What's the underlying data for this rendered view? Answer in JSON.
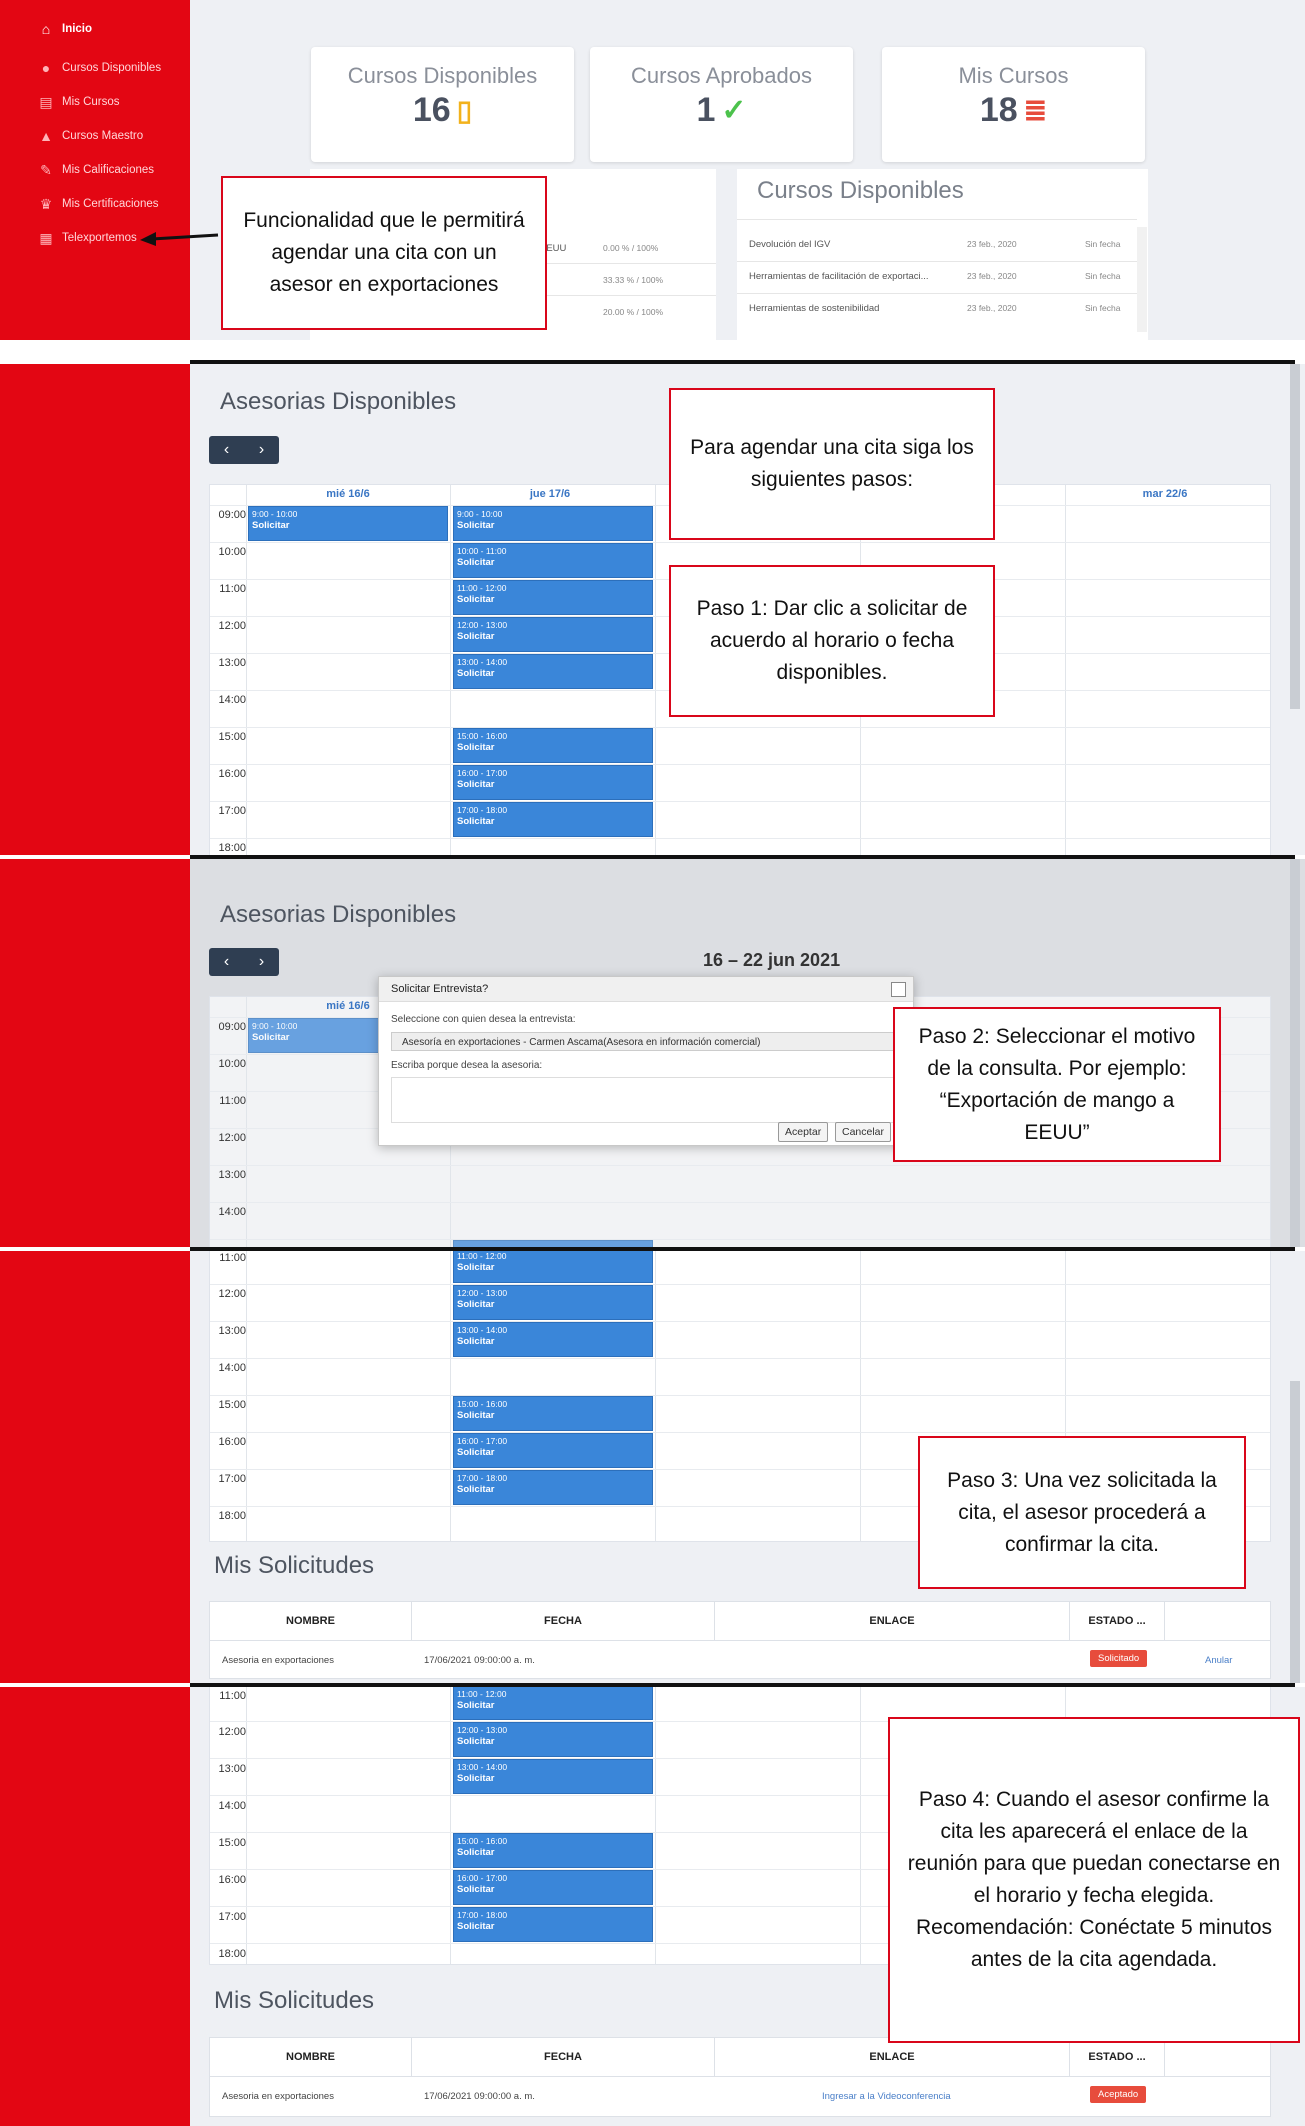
{
  "sidebar": {
    "items": [
      {
        "label": "Inicio",
        "icon": "home-icon"
      },
      {
        "label": "Cursos Disponibles",
        "icon": "circle-icon"
      },
      {
        "label": "Mis Cursos",
        "icon": "book-icon"
      },
      {
        "label": "Cursos Maestro",
        "icon": "graduation-cap-icon"
      },
      {
        "label": "Mis Calificaciones",
        "icon": "edit-icon"
      },
      {
        "label": "Mis Certificaciones",
        "icon": "trophy-icon"
      },
      {
        "label": "Telexportemos",
        "icon": "calendar-icon"
      }
    ]
  },
  "stats": [
    {
      "label": "Cursos Disponibles",
      "value": "16",
      "icon": "notebook-icon"
    },
    {
      "label": "Cursos Aprobados",
      "value": "1",
      "icon": "check-icon"
    },
    {
      "label": "Mis Cursos",
      "value": "18",
      "icon": "stack-icon"
    }
  ],
  "my_courses_panel": {
    "rows": [
      {
        "name": "EEUU",
        "progress": "0.00 % / 100%"
      },
      {
        "name": "",
        "progress": "33.33 % / 100%"
      },
      {
        "name": "",
        "progress": "20.00 % / 100%"
      }
    ]
  },
  "available_panel": {
    "title": "Cursos Disponibles",
    "rows": [
      {
        "name": "Devolución del IGV",
        "date": "23 feb., 2020",
        "status": "Sin fecha"
      },
      {
        "name": "Herramientas de facilitación de exportaci...",
        "date": "23 feb., 2020",
        "status": "Sin fecha"
      },
      {
        "name": "Herramientas de sostenibilidad",
        "date": "23 feb., 2020",
        "status": "Sin fecha"
      }
    ]
  },
  "notes": {
    "n1": "Funcionalidad que le permitirá agendar una cita con un asesor en exportaciones",
    "n2": "Para agendar una cita siga los siguientes pasos:",
    "n3": "Paso 1: Dar clic a solicitar de acuerdo al horario o fecha disponibles.",
    "n4": "Paso 2: Seleccionar el motivo de la consulta. Por ejemplo: “Exportación de mango a EEUU”",
    "n5": "Paso 3: Una vez solicitada la cita, el asesor procederá a confirmar la cita.",
    "n6": "Paso 4: Cuando el asesor confirme la cita les aparecerá el enlace de la reunión para que puedan conectarse en el horario y fecha elegida. Recomendación: Conéctate 5 minutos antes de la cita agendada."
  },
  "calendar": {
    "title": "Asesorias Disponibles",
    "range": "16 – 22 jun 2021",
    "prev": "‹",
    "next": "›",
    "days": [
      "mié 16/6",
      "jue 17/6",
      "mar 22/6"
    ],
    "times": [
      "09:00",
      "10:00",
      "11:00",
      "12:00",
      "13:00",
      "14:00",
      "15:00",
      "16:00",
      "17:00",
      "18:00"
    ],
    "solicitar": "Solicitar",
    "slots": {
      "s0900": "9:00 - 10:00",
      "s1000": "10:00 - 11:00",
      "s1100": "11:00 - 12:00",
      "s1200": "12:00 - 13:00",
      "s1300": "13:00 - 14:00",
      "s1500": "15:00 - 16:00",
      "s1600": "16:00 - 17:00",
      "s1700": "17:00 - 18:00"
    }
  },
  "modal": {
    "title": "Solicitar Entrevista?",
    "select_label": "Seleccione con quien desea la entrevista:",
    "select_value": "Asesoría en exportaciones - Carmen Ascama(Asesora en información comercial)",
    "reason_label": "Escriba porque desea la asesoria:",
    "accept": "Aceptar",
    "cancel": "Cancelar"
  },
  "requests": {
    "title": "Mis Solicitudes",
    "headers": [
      "NOMBRE",
      "FECHA",
      "ENLACE",
      "ESTADO ..."
    ],
    "row": {
      "name": "Asesoria en exportaciones",
      "date": "17/06/2021 09:00:00 a. m.",
      "link": "Ingresar a la Videoconferencia",
      "status_pending": "Solicitado",
      "status_accepted": "Aceptado",
      "cancel": "Anular"
    }
  }
}
